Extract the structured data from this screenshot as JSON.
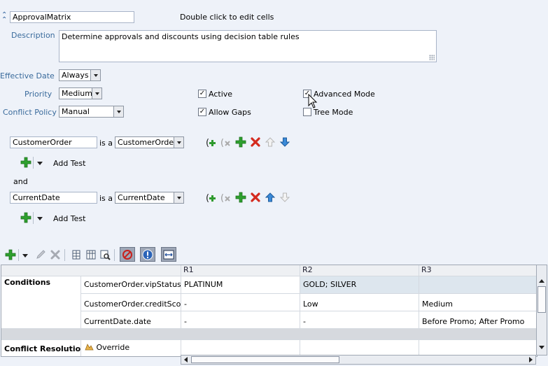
{
  "ruleset": {
    "name_value": "ApprovalMatrix",
    "hint": "Double click to edit cells",
    "description_label": "Description",
    "description_value": "Determine approvals and discounts using decision table rules",
    "effective_date_label": "Effective Date",
    "effective_date_value": "Always",
    "priority_label": "Priority",
    "priority_value": "Medium",
    "conflict_policy_label": "Conflict Policy",
    "conflict_policy_value": "Manual",
    "active_label": "Active",
    "active_checked": true,
    "allow_gaps_label": "Allow Gaps",
    "allow_gaps_checked": true,
    "advanced_mode_label": "Advanced Mode",
    "advanced_mode_checked": true,
    "tree_mode_label": "Tree Mode",
    "tree_mode_checked": false
  },
  "patterns": [
    {
      "var_value": "CustomerOrder",
      "is_a": "is a",
      "type_value": "CustomerOrder",
      "add_test_label": "Add Test"
    },
    {
      "var_value": "CurrentDate",
      "is_a": "is a",
      "type_value": "CurrentDate",
      "add_test_label": "Add Test"
    }
  ],
  "and_label": "and",
  "table": {
    "columns": [
      "R1",
      "R2",
      "R3"
    ],
    "conditions_label": "Conditions",
    "conditions": [
      {
        "name": "CustomerOrder.vipStatus",
        "values": [
          "PLATINUM",
          "GOLD; SILVER",
          ""
        ]
      },
      {
        "name": "CustomerOrder.creditScore",
        "values": [
          "-",
          "Low",
          "Medium"
        ]
      },
      {
        "name": "CurrentDate.date",
        "values": [
          "-",
          "-",
          "Before Promo; After Promo"
        ]
      }
    ],
    "conflict_resolution_label": "Conflict Resolution",
    "override_label": "Override"
  }
}
